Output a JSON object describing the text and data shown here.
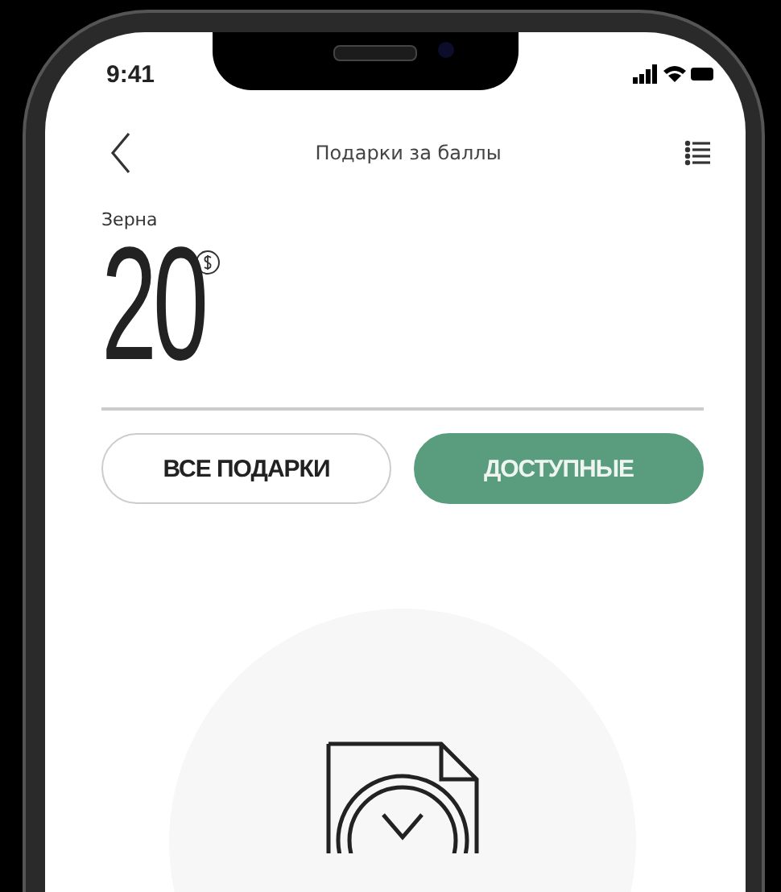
{
  "status_bar": {
    "time": "9:41"
  },
  "header": {
    "title": "Подарки за баллы"
  },
  "balance": {
    "label": "Зерна",
    "value": "20"
  },
  "tabs": [
    {
      "label": "ВСЕ ПОДАРКИ",
      "selected": false
    },
    {
      "label": "ДОСТУПНЫЕ",
      "selected": true
    }
  ]
}
